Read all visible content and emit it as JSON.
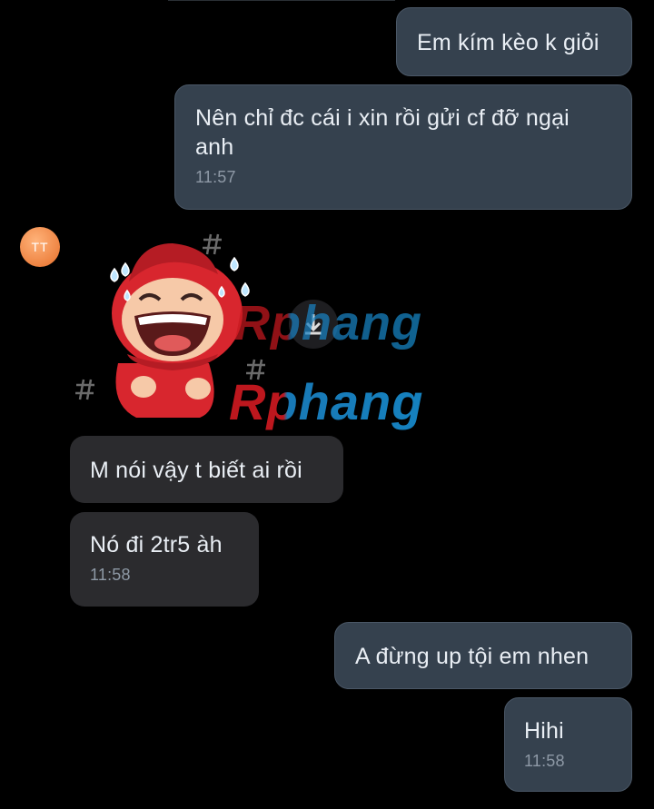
{
  "messages": [
    {
      "text": "Em kím kèo k giỏi",
      "time": ""
    },
    {
      "text": "Nên chỉ đc cái i xin rồi gửi cf đỡ ngại\nanh",
      "time": "11:57"
    },
    {
      "avatar_initials": "TT"
    },
    {
      "text": "M nói vậy t biết ai rồi",
      "time": ""
    },
    {
      "text": "Nó đi 2tr5 àh",
      "time": "11:58"
    },
    {
      "text": "A đừng up tội em nhen",
      "time": ""
    },
    {
      "text": "Hihi",
      "time": "11:58"
    }
  ],
  "watermark": {
    "text_1": "Rphang",
    "text_2": "Rphang"
  },
  "colors": {
    "background": "#000000",
    "outgoing_bubble": "#35414e",
    "incoming_bubble": "#2b2b2e",
    "timestamp": "#8e99a6",
    "avatar": "#e76f2a",
    "sticker_red": "#d8262e"
  }
}
